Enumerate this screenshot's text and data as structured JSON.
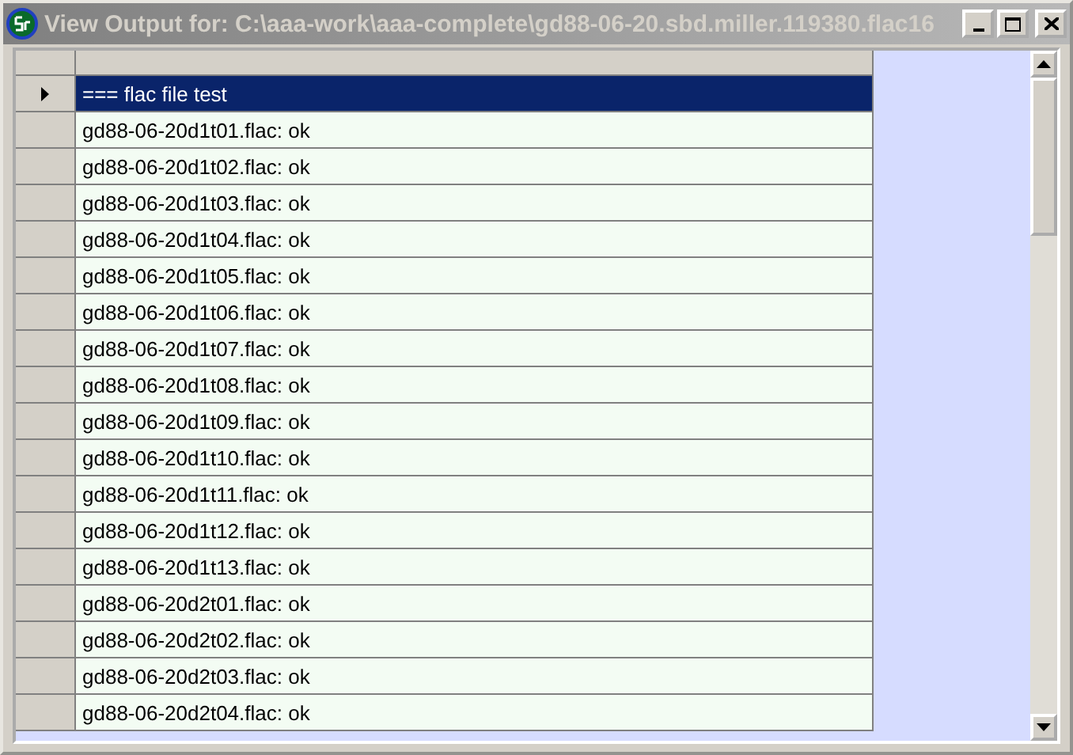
{
  "window": {
    "title": "View Output for: C:\\aaa-work\\aaa-complete\\gd88-06-20.sbd.miller.119380.flac16",
    "active": false
  },
  "rows": [
    {
      "text": "=== flac file test",
      "selected": true
    },
    {
      "text": "gd88-06-20d1t01.flac: ok",
      "selected": false
    },
    {
      "text": "gd88-06-20d1t02.flac: ok",
      "selected": false
    },
    {
      "text": "gd88-06-20d1t03.flac: ok",
      "selected": false
    },
    {
      "text": "gd88-06-20d1t04.flac: ok",
      "selected": false
    },
    {
      "text": "gd88-06-20d1t05.flac: ok",
      "selected": false
    },
    {
      "text": "gd88-06-20d1t06.flac: ok",
      "selected": false
    },
    {
      "text": "gd88-06-20d1t07.flac: ok",
      "selected": false
    },
    {
      "text": "gd88-06-20d1t08.flac: ok",
      "selected": false
    },
    {
      "text": "gd88-06-20d1t09.flac: ok",
      "selected": false
    },
    {
      "text": "gd88-06-20d1t10.flac: ok",
      "selected": false
    },
    {
      "text": "gd88-06-20d1t11.flac: ok",
      "selected": false
    },
    {
      "text": "gd88-06-20d1t12.flac: ok",
      "selected": false
    },
    {
      "text": "gd88-06-20d1t13.flac: ok",
      "selected": false
    },
    {
      "text": "gd88-06-20d2t01.flac: ok",
      "selected": false
    },
    {
      "text": "gd88-06-20d2t02.flac: ok",
      "selected": false
    },
    {
      "text": "gd88-06-20d2t03.flac: ok",
      "selected": false
    },
    {
      "text": "gd88-06-20d2t04.flac: ok",
      "selected": false
    }
  ]
}
